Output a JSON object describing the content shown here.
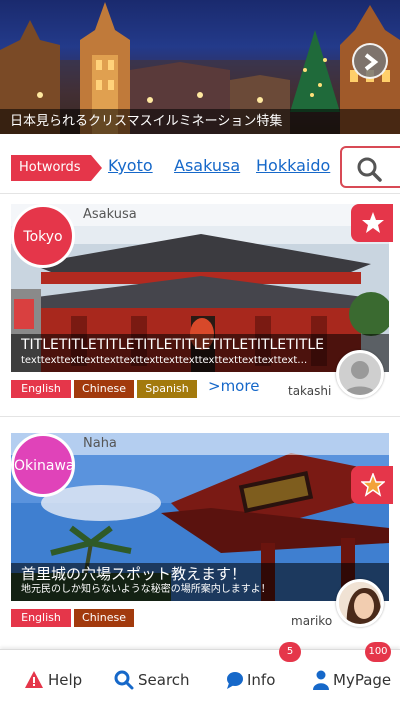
{
  "colors": {
    "accent": "#e5364a",
    "link": "#1668c9",
    "tokyo": "#e5364a",
    "okinawa": "#e043b9",
    "english": "#e5364a",
    "chinese": "#a23a0d",
    "spanish": "#a37a0d"
  },
  "hero": {
    "caption": "日本見られるクリスマスイルミネーション特集",
    "next_icon": "chevron-right-icon"
  },
  "hotwords": {
    "label": "Hotwords",
    "links": [
      "Kyoto",
      "Asakusa",
      "Hokkaido"
    ],
    "search_icon": "search-icon"
  },
  "cards": [
    {
      "city": "Tokyo",
      "place": "Asakusa",
      "title": "TITLETITLETITLETITLETITLETITLETITLETITLE",
      "subtitle": "texttexttexttexttexttexttexttexttexttexttexttexttexttext…",
      "tags": [
        "English",
        "Chinese",
        "Spanish"
      ],
      "more": ">more",
      "author": "takashi",
      "favorite": "star-icon"
    },
    {
      "city": "Okinawa",
      "place": "Naha",
      "title": "首里城の穴場スポット教えます！",
      "subtitle": "地元民のしか知らないような秘密の場所案内しますよ！",
      "tags": [
        "English",
        "Chinese"
      ],
      "author": "mariko",
      "favorite": "star-icon"
    }
  ],
  "nav": [
    {
      "label": "Help",
      "icon": "warning-icon"
    },
    {
      "label": "Search",
      "icon": "search-icon"
    },
    {
      "label": "Info",
      "icon": "speech-bubble-icon",
      "badge": "5"
    },
    {
      "label": "MyPage",
      "icon": "user-icon",
      "badge": "100"
    }
  ]
}
